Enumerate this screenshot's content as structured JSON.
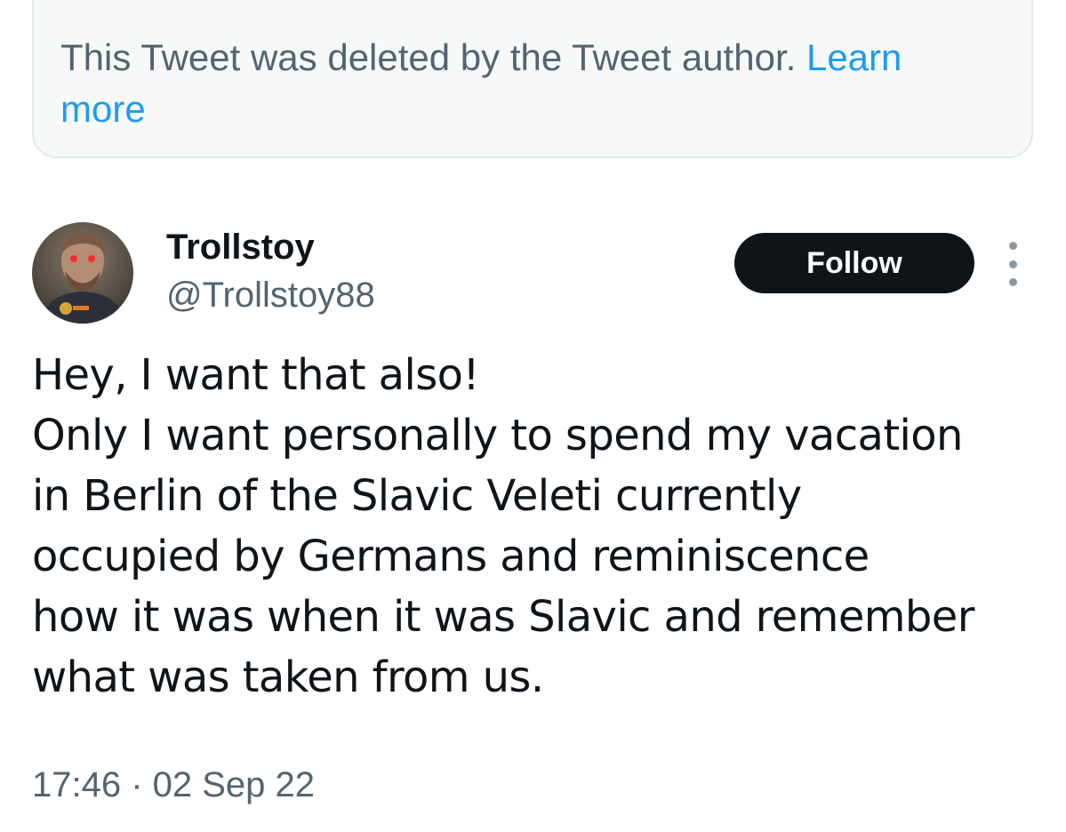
{
  "notice": {
    "text": "This Tweet was deleted by the Tweet author.",
    "learn_more_line1": "Learn",
    "learn_more_line2": "more"
  },
  "author": {
    "display_name": "Trollstoy",
    "handle": "@Trollstoy88"
  },
  "actions": {
    "follow_label": "Follow",
    "more_icon": "more-vertical-icon"
  },
  "tweet": {
    "lines": [
      "Hey, I want that also!",
      "Only I want personally to spend my vacation",
      "in Berlin of the Slavic Veleti currently",
      "occupied by Germans and reminiscence",
      "how it was when it was Slavic and remember",
      "what was taken from us."
    ],
    "timestamp": "17:46 · 02 Sep 22"
  },
  "colors": {
    "link": "#1d9bf0",
    "secondary_text": "#536471",
    "primary_text": "#0f1419",
    "notice_bg": "#f7f9f9"
  }
}
